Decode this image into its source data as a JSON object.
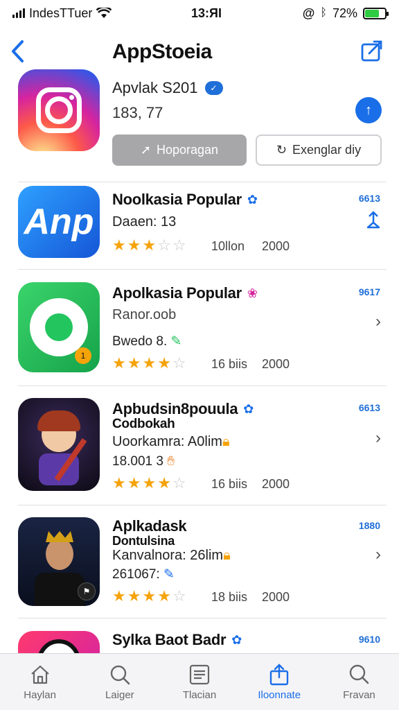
{
  "status": {
    "carrier": "IndesTTuer",
    "time": "13:ЯI",
    "battery": "72%",
    "battery_level": 0.72,
    "battery_color": "#2ecc40"
  },
  "header": {
    "title": "AppStoeia"
  },
  "featured": {
    "developer": "Apvlak S201",
    "count": "183, 77",
    "primary_button": "Hoporagan",
    "secondary_button": "Exenglar diy",
    "icon": "instagram-style-icon"
  },
  "apps": [
    {
      "name": "Noolkasia Popular",
      "sub": "Daaen: 13",
      "sub2": "",
      "rating": 3,
      "meta": "10llon",
      "year": "2000",
      "rank": "6613",
      "icon": "app-logo-icon",
      "accent": "#1a6ee8"
    },
    {
      "name": "Apolkasia Popular",
      "sub": "Ranor.oob",
      "sub2": "Bwedo 8.",
      "rating": 4,
      "meta": "16 biis",
      "year": "2000",
      "rank": "9617",
      "icon": "chat-bubble-icon",
      "accent": "#22c55e"
    },
    {
      "name": "Apbudsin8pouula",
      "name2": "Codbokah",
      "sub": "Uoorkamra: A0lim",
      "sub2": "18.001 3",
      "rating": 4,
      "meta": "16 biis",
      "year": "2000",
      "rank": "6613",
      "icon": "character-icon"
    },
    {
      "name": "Aplkadask",
      "name2": "Dontulsina",
      "sub": "Kanvalnora: 26lim",
      "sub2": "261067:",
      "rating": 4,
      "meta": "18 biis",
      "year": "2000",
      "rank": "1880",
      "icon": "portrait-icon"
    },
    {
      "name": "Sylka Baot Badr",
      "name2": "",
      "sub": "",
      "sub2": "",
      "rating": 0,
      "meta": "",
      "year": "",
      "rank": "9610",
      "icon": "app-icon"
    }
  ],
  "tabs": [
    {
      "label": "Haylan",
      "icon": "home-icon"
    },
    {
      "label": "Laiger",
      "icon": "search-chat-icon"
    },
    {
      "label": "Tlacian",
      "icon": "list-icon"
    },
    {
      "label": "Iloonnate",
      "icon": "share-upload-icon",
      "active": true
    },
    {
      "label": "Fravan",
      "icon": "search-icon"
    }
  ],
  "colors": {
    "accent": "#1a6ee8",
    "star": "#f5a30b"
  }
}
